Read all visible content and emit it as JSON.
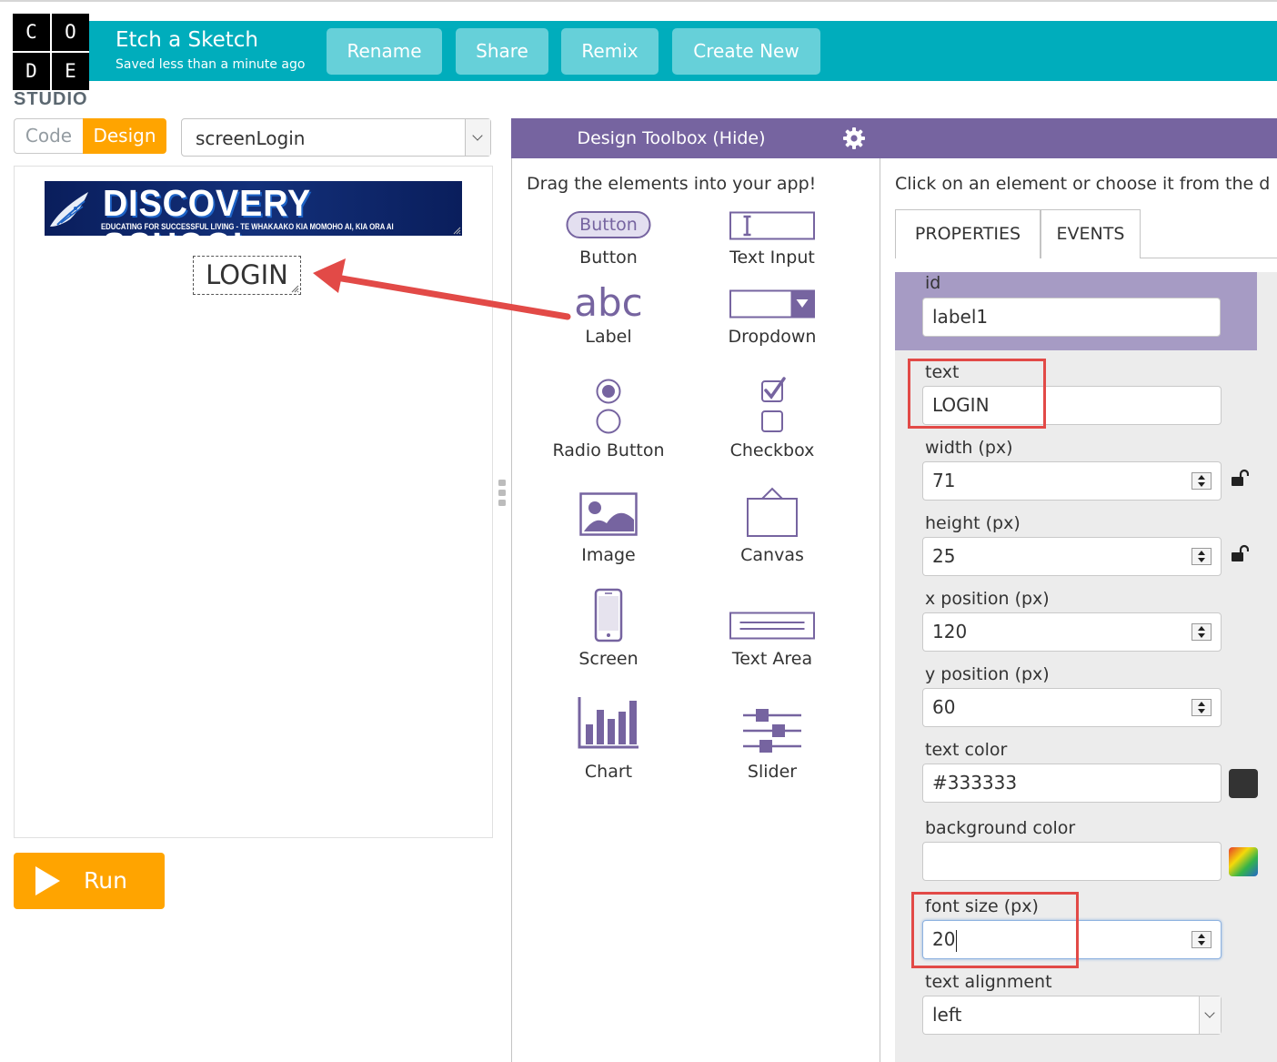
{
  "header": {
    "logo_letters": [
      "C",
      "O",
      "D",
      "E"
    ],
    "logo_studio": "STUDIO",
    "project_title": "Etch a Sketch",
    "save_status": "Saved less than a minute ago",
    "buttons": {
      "rename": "Rename",
      "share": "Share",
      "remix": "Remix",
      "create_new": "Create New"
    },
    "accent_color": "#00adbc"
  },
  "mode_toggle": {
    "code": "Code",
    "design": "Design",
    "active": "Design"
  },
  "screen_select": {
    "value": "screenLogin"
  },
  "app_preview": {
    "banner_title": "DISCOVERY SCHOOL",
    "banner_subtitle": "EDUCATING FOR SUCCESSFUL LIVING - TE WHAKAAKO KIA MOMOHO AI, KIA ORA AI",
    "label_text": "LOGIN"
  },
  "run_button": {
    "label": "Run"
  },
  "toolbox": {
    "title": "Design Toolbox (Hide)",
    "instruction": "Drag the elements into your app!",
    "button_sample": "Button",
    "label_sample": "abc",
    "items": [
      {
        "label": "Button",
        "icon": "button-icon"
      },
      {
        "label": "Text Input",
        "icon": "text-input-icon"
      },
      {
        "label": "Label",
        "icon": "label-icon"
      },
      {
        "label": "Dropdown",
        "icon": "dropdown-icon"
      },
      {
        "label": "Radio Button",
        "icon": "radio-button-icon"
      },
      {
        "label": "Checkbox",
        "icon": "checkbox-icon"
      },
      {
        "label": "Image",
        "icon": "image-icon"
      },
      {
        "label": "Canvas",
        "icon": "canvas-icon"
      },
      {
        "label": "Screen",
        "icon": "screen-icon"
      },
      {
        "label": "Text Area",
        "icon": "text-area-icon"
      },
      {
        "label": "Chart",
        "icon": "chart-icon"
      },
      {
        "label": "Slider",
        "icon": "slider-icon"
      }
    ]
  },
  "properties": {
    "instruction": "Click on an element or choose it from the d",
    "tabs": [
      "PROPERTIES",
      "EVENTS"
    ],
    "active_tab": "PROPERTIES",
    "fields": {
      "id": {
        "label": "id",
        "value": "label1"
      },
      "text": {
        "label": "text",
        "value": "LOGIN"
      },
      "width": {
        "label": "width (px)",
        "value": "71"
      },
      "height": {
        "label": "height (px)",
        "value": "25"
      },
      "x": {
        "label": "x position (px)",
        "value": "120"
      },
      "y": {
        "label": "y position (px)",
        "value": "60"
      },
      "text_color": {
        "label": "text color",
        "value": "#333333"
      },
      "background_color": {
        "label": "background color",
        "value": ""
      },
      "font_size": {
        "label": "font size (px)",
        "value": "20"
      },
      "text_alignment": {
        "label": "text alignment",
        "value": "left"
      }
    }
  },
  "colors": {
    "toolbox_purple": "#7664a0",
    "design_orange": "#ffa400",
    "annotation_red": "#e24a47"
  }
}
